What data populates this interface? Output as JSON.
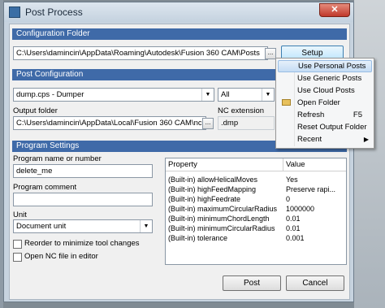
{
  "window": {
    "title": "Post Process",
    "close_glyph": "✕"
  },
  "config_folder": {
    "header": "Configuration Folder",
    "path": "C:\\Users\\damincin\\AppData\\Roaming\\Autodesk\\Fusion 360 CAM\\Posts",
    "browse_label": "...",
    "setup_label": "Setup"
  },
  "post_config": {
    "header": "Post Configuration",
    "post_selected": "dump.cps - Dumper",
    "filter_selected": "All",
    "output_folder_label": "Output folder",
    "output_folder": "C:\\Users\\damincin\\AppData\\Local\\Fusion 360 CAM\\nc",
    "browse_label": "...",
    "nc_ext_label": "NC extension",
    "nc_ext": ".dmp"
  },
  "program": {
    "header": "Program Settings",
    "name_label": "Program name or number",
    "name_value": "delete_me",
    "comment_label": "Program comment",
    "comment_value": "",
    "unit_label": "Unit",
    "unit_selected": "Document unit",
    "reorder_label": "Reorder to minimize tool changes",
    "open_nc_label": "Open NC file in editor"
  },
  "properties": {
    "col_property": "Property",
    "col_value": "Value",
    "rows": [
      {
        "property": "(Built-in) allowHelicalMoves",
        "value": "Yes"
      },
      {
        "property": "(Built-in) highFeedMapping",
        "value": "Preserve rapi..."
      },
      {
        "property": "(Built-in) highFeedrate",
        "value": "0"
      },
      {
        "property": "(Built-in) maximumCircularRadius",
        "value": "1000000"
      },
      {
        "property": "(Built-in) minimumChordLength",
        "value": "0.01"
      },
      {
        "property": "(Built-in) minimumCircularRadius",
        "value": "0.01"
      },
      {
        "property": "(Built-in) tolerance",
        "value": "0.001"
      }
    ]
  },
  "footer": {
    "post_label": "Post",
    "cancel_label": "Cancel"
  },
  "setup_menu": {
    "items": [
      {
        "label": "Use Personal Posts",
        "shortcut": "",
        "icon": "",
        "submenu": false
      },
      {
        "label": "Use Generic Posts",
        "shortcut": "",
        "icon": "",
        "submenu": false
      },
      {
        "label": "Use Cloud Posts",
        "shortcut": "",
        "icon": "",
        "submenu": false
      },
      {
        "label": "Open Folder",
        "shortcut": "",
        "icon": "folder-icon",
        "submenu": false
      },
      {
        "label": "Refresh",
        "shortcut": "F5",
        "icon": "",
        "submenu": false
      },
      {
        "label": "Reset Output Folder",
        "shortcut": "",
        "icon": "",
        "submenu": false
      },
      {
        "label": "Recent",
        "shortcut": "",
        "icon": "",
        "submenu": true
      }
    ],
    "submenu_glyph": "▶"
  },
  "colors": {
    "section_header": "#3f6aa8",
    "menu_highlight": "#c4dcf4"
  }
}
